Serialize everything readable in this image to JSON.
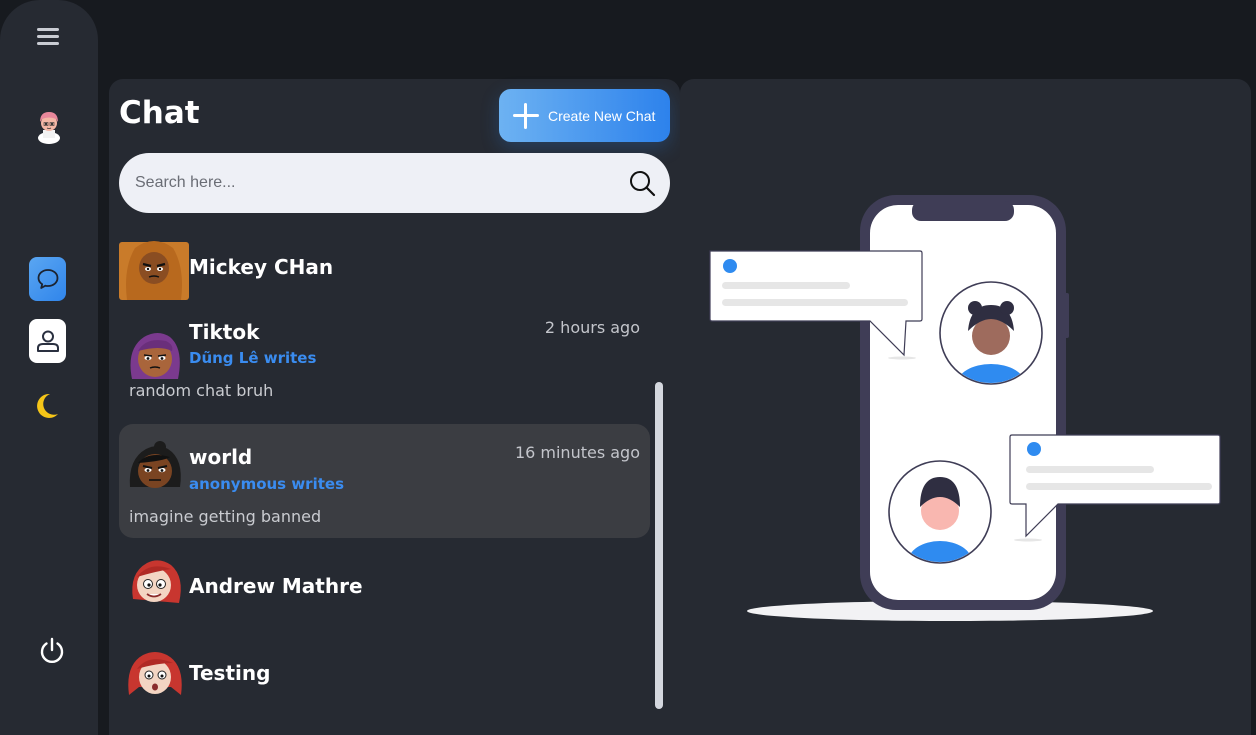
{
  "sidebar": {
    "menu_icon": "hamburger-icon",
    "avatar_icon": "user-avatar",
    "items": [
      {
        "icon": "chat-bubble-icon",
        "active": true
      },
      {
        "icon": "person-icon",
        "active": false
      },
      {
        "icon": "moon-icon",
        "active": false
      }
    ],
    "power_icon": "power-icon"
  },
  "chat": {
    "title": "Chat",
    "create_button_label": "Create New Chat",
    "search": {
      "placeholder": "Search here..."
    },
    "items": [
      {
        "name": "Mickey CHan",
        "time": "",
        "writer": "",
        "preview": "",
        "active": false,
        "avatar_color": "#c97b2a"
      },
      {
        "name": "Tiktok",
        "time": "2 hours ago",
        "writer": "Dũng Lê writes",
        "preview": "random chat bruh",
        "active": false,
        "avatar_color": "#7b3a8e"
      },
      {
        "name": "world",
        "time": "16 minutes ago",
        "writer": "anonymous writes",
        "preview": "imagine getting banned",
        "active": true,
        "avatar_color": "#1c1c1c"
      },
      {
        "name": "Andrew Mathre",
        "time": "",
        "writer": "",
        "preview": "",
        "active": false,
        "avatar_color": "#c8362f"
      },
      {
        "name": "Testing",
        "time": "",
        "writer": "",
        "preview": "",
        "active": false,
        "avatar_color": "#c8362f"
      }
    ]
  },
  "colors": {
    "background": "#171a1f",
    "panel": "#262a32",
    "accent": "#3a8cf0",
    "active_item": "#3b3d42",
    "moon": "#f5c518"
  }
}
